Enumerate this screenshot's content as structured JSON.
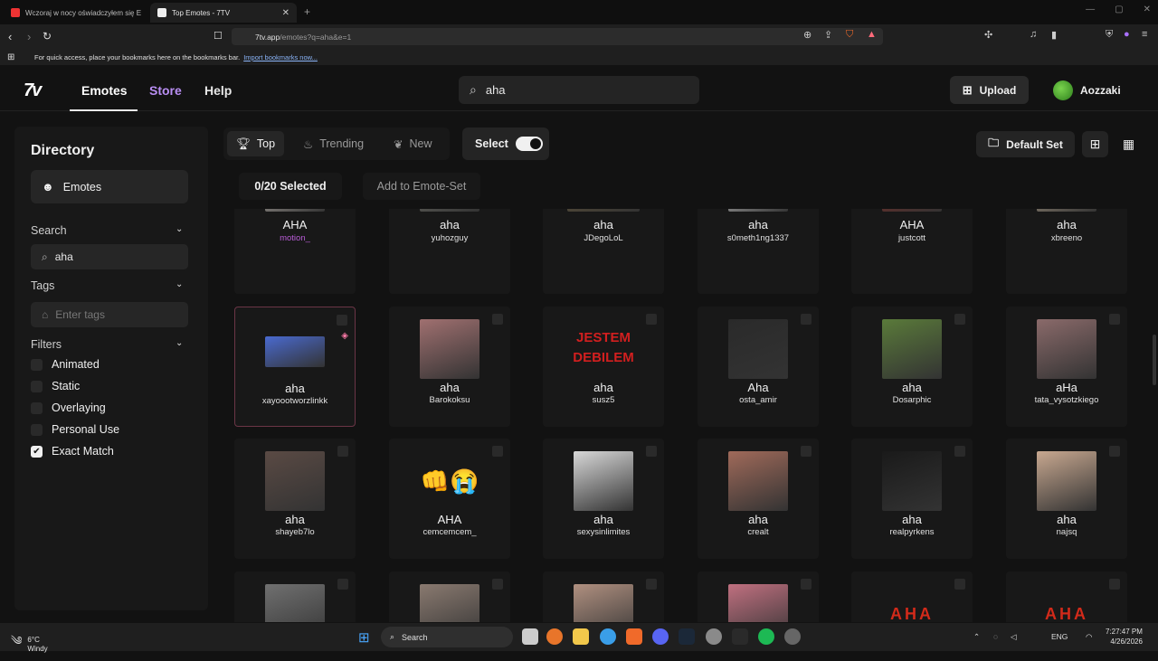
{
  "browser": {
    "tabs": [
      {
        "title": "Wczoraj w nocy oświadczyłem się E...",
        "active": false
      },
      {
        "title": "Top Emotes - 7TV",
        "active": true
      }
    ],
    "url_host": "7tv.app",
    "url_path": "/emotes?q=aha&e=1",
    "bookmark_hint": "For quick access, place your bookmarks here on the bookmarks bar.",
    "bookmark_link": "Import bookmarks now..."
  },
  "header": {
    "logo": "7v",
    "nav": [
      {
        "label": "Emotes",
        "active": true
      },
      {
        "label": "Store",
        "active": false
      },
      {
        "label": "Help",
        "active": false
      }
    ],
    "search_value": "aha",
    "upload_label": "Upload",
    "username": "Aozzaki"
  },
  "sidebar": {
    "title": "Directory",
    "emotes_label": "Emotes",
    "search_label": "Search",
    "search_value": "aha",
    "tags_label": "Tags",
    "tags_placeholder": "Enter tags",
    "filters_label": "Filters",
    "filters": [
      {
        "label": "Animated",
        "checked": false
      },
      {
        "label": "Static",
        "checked": false
      },
      {
        "label": "Overlaying",
        "checked": false
      },
      {
        "label": "Personal Use",
        "checked": false
      },
      {
        "label": "Exact Match",
        "checked": true
      }
    ]
  },
  "toolbar": {
    "sort_tabs": [
      {
        "label": "Top",
        "active": true,
        "icon": "trophy-icon"
      },
      {
        "label": "Trending",
        "active": false,
        "icon": "flame-icon"
      },
      {
        "label": "New",
        "active": false,
        "icon": "sprout-icon"
      }
    ],
    "select_label": "Select",
    "selected_count": "0/20 Selected",
    "add_to_set": "Add to Emote-Set",
    "default_set": "Default Set"
  },
  "emotes": [
    {
      "name": "AHA",
      "owner": "motion_",
      "paint": true,
      "thumb": "#d8d0c8"
    },
    {
      "name": "aha",
      "owner": "yuhozguy",
      "thumb": "#7a7a72"
    },
    {
      "name": "aha",
      "owner": "JDegoLoL",
      "thumb": "#6a5a3a"
    },
    {
      "name": "aha",
      "owner": "s0meth1ng1337",
      "thumb": "#e8e8e8"
    },
    {
      "name": "AHA",
      "owner": "justcott",
      "thumb": "#8a2a22"
    },
    {
      "name": "aha",
      "owner": "xbreeno",
      "thumb": "#c7b49a"
    },
    {
      "name": "aha",
      "owner": "xayoootworzlinkk",
      "thumb": "#4a6ad0",
      "selected": true
    },
    {
      "name": "aha",
      "owner": "Barokoksu",
      "thumb": "#a07070"
    },
    {
      "name": "aha",
      "owner": "susz5",
      "thumb": "text",
      "text": "JESTEM DEBILEM"
    },
    {
      "name": "Aha",
      "owner": "osta_amir",
      "thumb": "#2a2a2a"
    },
    {
      "name": "aha",
      "owner": "Dosarphic",
      "thumb": "#5a7a3a"
    },
    {
      "name": "aHa",
      "owner": "tata_vysotzkiego",
      "thumb": "#8a6a6a"
    },
    {
      "name": "aha",
      "owner": "shayeb7lo",
      "thumb": "#5a4a44"
    },
    {
      "name": "AHA",
      "owner": "cemcemcem_",
      "thumb": "emoji",
      "text": "👊😭"
    },
    {
      "name": "aha",
      "owner": "sexysinlimites",
      "thumb": "#d8d8d8"
    },
    {
      "name": "aha",
      "owner": "crealt",
      "thumb": "#a06a5a"
    },
    {
      "name": "aha",
      "owner": "realpyrkens",
      "thumb": "#1a1a1a"
    },
    {
      "name": "aha",
      "owner": "najsq",
      "thumb": "#c8a890"
    },
    {
      "name": "",
      "owner": "",
      "thumb": "#707070"
    },
    {
      "name": "",
      "owner": "",
      "thumb": "#8a7a70"
    },
    {
      "name": "",
      "owner": "",
      "thumb": "#b09080"
    },
    {
      "name": "",
      "owner": "",
      "thumb": "#c07080"
    },
    {
      "name": "",
      "owner": "",
      "thumb": "text-red",
      "text": "AHA"
    },
    {
      "name": "",
      "owner": "",
      "thumb": "text-red",
      "text": "AHA"
    }
  ],
  "taskbar": {
    "temp": "6°C",
    "weather": "Windy",
    "search": "Search",
    "lang": "ENG",
    "time": "7:27:47 PM",
    "date": "4/26/2026"
  }
}
